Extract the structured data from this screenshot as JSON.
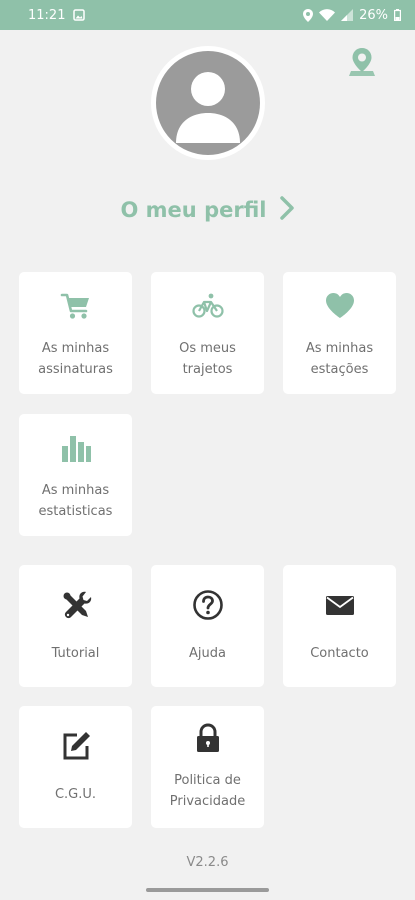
{
  "status_bar": {
    "time": "11:21",
    "battery": "26%"
  },
  "profile": {
    "label": "O meu perfil"
  },
  "tiles": {
    "subscriptions": {
      "line1": "As minhas",
      "line2": "assinaturas",
      "icon": "cart-icon"
    },
    "trips": {
      "line1": "Os meus",
      "line2": "trajetos",
      "icon": "bicycle-icon"
    },
    "stations": {
      "line1": "As minhas",
      "line2": "estações",
      "icon": "heart-icon"
    },
    "statistics": {
      "line1": "As minhas",
      "line2": "estatisticas",
      "icon": "bar-chart-icon"
    },
    "tutorial": {
      "label": "Tutorial",
      "icon": "tools-icon"
    },
    "help": {
      "label": "Ajuda",
      "icon": "question-icon"
    },
    "contact": {
      "label": "Contacto",
      "icon": "envelope-icon"
    },
    "terms": {
      "label": "C.G.U.",
      "icon": "edit-icon"
    },
    "privacy": {
      "line1": "Politica de",
      "line2": "Privacidade",
      "icon": "lock-icon"
    }
  },
  "version": "V2.2.6",
  "colors": {
    "accent": "#8fc1a9",
    "dark_icon": "#333333",
    "label": "#707070",
    "background": "#f1f1f1"
  }
}
